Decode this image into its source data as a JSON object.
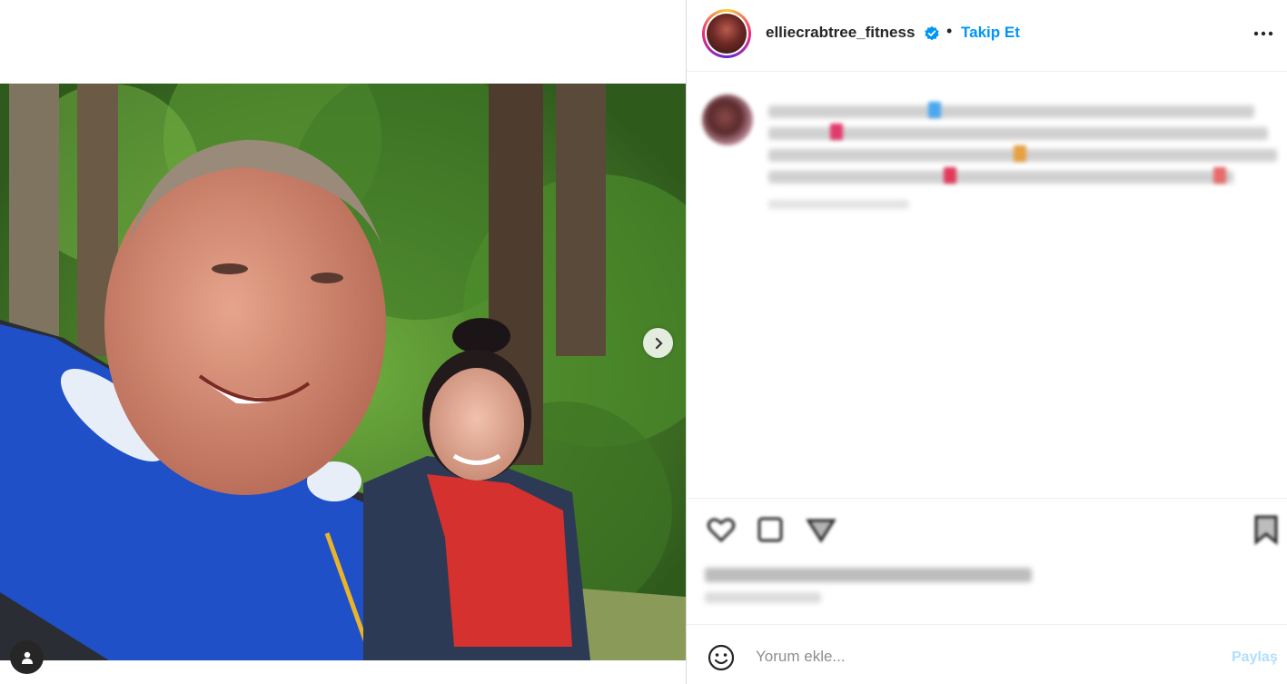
{
  "post": {
    "username": "elliecrabtree_fitness",
    "follow_label": "Takip Et",
    "separator": "•",
    "verified_icon": "verified-badge-icon",
    "more_icon": "more-options-icon"
  },
  "media": {
    "next_icon": "chevron-right-icon",
    "tag_icon": "user-tag-icon"
  },
  "comment": {
    "placeholder": "Yorum ekle...",
    "share_label": "Paylaş",
    "emoji_icon": "emoji-smile-icon"
  },
  "colors": {
    "accent": "#0095f6",
    "share_disabled": "#b2dffc",
    "text": "#262626",
    "muted": "#8e8e8e",
    "border": "#efefef"
  }
}
